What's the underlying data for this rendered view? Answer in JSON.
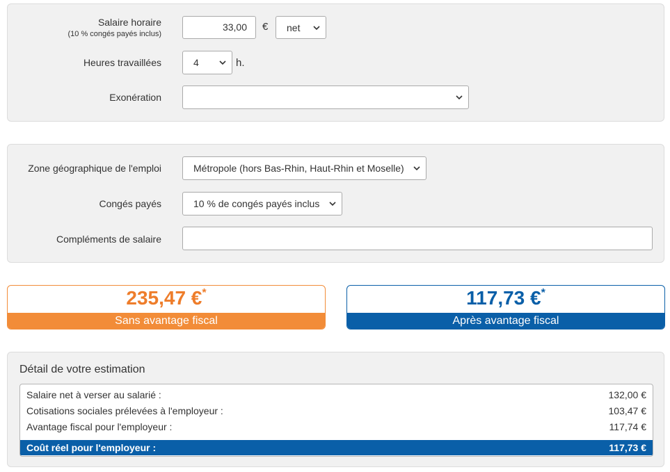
{
  "form1": {
    "hourly_wage_label": "Salaire horaire",
    "hourly_wage_sublabel": "(10 % congés payés inclus)",
    "hourly_wage_value": "33,00",
    "currency_symbol": "€",
    "wage_type_selected": "net",
    "hours_label": "Heures travaillées",
    "hours_selected": "4",
    "hours_unit": "h.",
    "exoneration_label": "Exonération",
    "exoneration_selected": ""
  },
  "form2": {
    "zone_label": "Zone géographique de l'emploi",
    "zone_selected": "Métropole (hors Bas-Rhin, Haut-Rhin et Moselle)",
    "paid_leave_label": "Congés payés",
    "paid_leave_selected": "10 % de congés payés inclus",
    "supplements_label": "Compléments de salaire",
    "supplements_value": ""
  },
  "results": {
    "without_amount": "235,47 €",
    "without_mark": "*",
    "without_label": "Sans avantage fiscal",
    "with_amount": "117,73 €",
    "with_mark": "*",
    "with_label": "Après avantage fiscal"
  },
  "detail": {
    "title": "Détail de votre estimation",
    "rows": [
      {
        "label": "Salaire net à verser au salarié :",
        "value": "132,00 €"
      },
      {
        "label": "Cotisations sociales prélevées à l'employeur :",
        "value": "103,47 €"
      },
      {
        "label": "Avantage fiscal pour l'employeur :",
        "value": "117,74 €"
      }
    ],
    "total": {
      "label": "Coût réel pour l'employeur :",
      "value": "117,73 €"
    }
  },
  "colors": {
    "orange": "#f28c38",
    "blue": "#0a5fa8",
    "panel_bg": "#f1f1f1"
  },
  "icons": {
    "select_arrow": "chevron-down-icon"
  }
}
